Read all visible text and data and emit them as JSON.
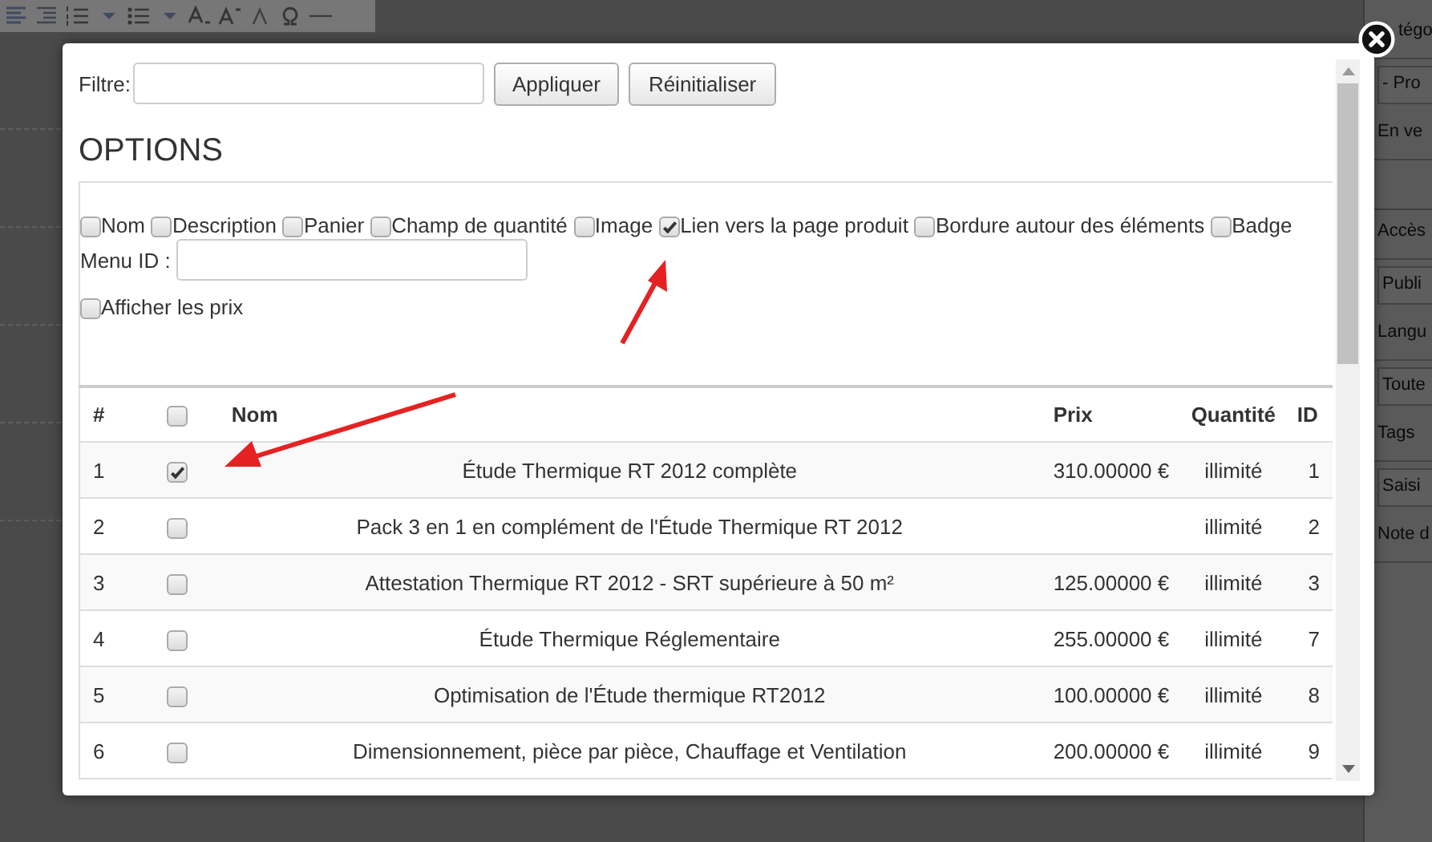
{
  "sidebar": {
    "items": [
      {
        "kind": "label",
        "text": "tégo"
      },
      {
        "kind": "field",
        "text": "- Pro"
      },
      {
        "kind": "label",
        "text": "En ve"
      },
      {
        "kind": "blank"
      },
      {
        "kind": "label",
        "text": "Accès"
      },
      {
        "kind": "field",
        "text": "Publi"
      },
      {
        "kind": "label",
        "text": "Langu"
      },
      {
        "kind": "field",
        "text": "Toute"
      },
      {
        "kind": "label",
        "text": "Tags"
      },
      {
        "kind": "field",
        "text": "Saisi"
      },
      {
        "kind": "label",
        "text": "Note d"
      }
    ]
  },
  "dialog": {
    "filter": {
      "label": "Filtre:"
    },
    "buttons": [
      "Appliquer",
      "Réinitialiser"
    ],
    "heading": "OPTIONS",
    "options": [
      {
        "label": "Nom",
        "checked": false
      },
      {
        "label": "Description",
        "checked": false
      },
      {
        "label": "Panier",
        "checked": false
      },
      {
        "label": "Champ de quantité",
        "checked": false
      },
      {
        "label": "Image",
        "checked": false
      },
      {
        "label": "Lien vers la page produit",
        "checked": true
      },
      {
        "label": "Bordure autour des éléments",
        "checked": false
      },
      {
        "label": "Badge",
        "checked": false
      }
    ],
    "menu_id": {
      "label": "Menu ID :"
    },
    "show_prices": {
      "label": "Afficher les prix",
      "checked": false
    },
    "table": {
      "columns": [
        "#",
        "Nom",
        "Prix",
        "Quantité",
        "ID"
      ],
      "select_all": {
        "checked": false
      },
      "rows": [
        {
          "num": "1",
          "checked": true,
          "name": "Étude Thermique RT 2012 complète",
          "price": "310.00000 €",
          "quantity": "illimité",
          "id": "1"
        },
        {
          "num": "2",
          "checked": false,
          "name": "Pack 3 en 1 en complément de l'Étude Thermique RT 2012",
          "quantity": "illimité",
          "id": "2"
        },
        {
          "num": "3",
          "checked": false,
          "name": "Attestation Thermique RT 2012 - SRT supérieure à 50 m²",
          "price": "125.00000 €",
          "quantity": "illimité",
          "id": "3"
        },
        {
          "num": "4",
          "checked": false,
          "name": "Étude Thermique Réglementaire",
          "price": "255.00000 €",
          "quantity": "illimité",
          "id": "7"
        },
        {
          "num": "5",
          "checked": false,
          "name": "Optimisation de l'Étude thermique RT2012",
          "price": "100.00000 €",
          "quantity": "illimité",
          "id": "8"
        },
        {
          "num": "6",
          "checked": false,
          "name": "Dimensionnement, pièce par pièce, Chauffage et Ventilation",
          "price": "200.00000 €",
          "quantity": "illimité",
          "id": "9"
        }
      ]
    }
  }
}
